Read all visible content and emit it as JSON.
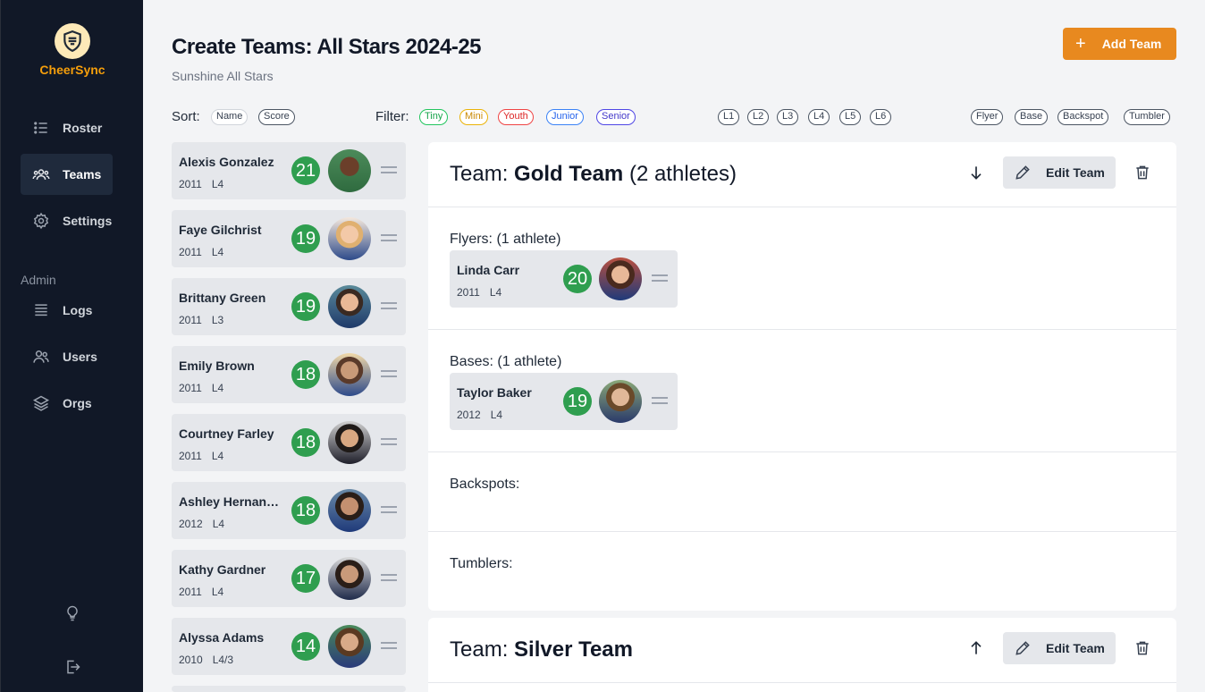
{
  "app": {
    "name": "CheerSync"
  },
  "nav": {
    "items": [
      {
        "label": "Roster",
        "icon": "list-icon"
      },
      {
        "label": "Teams",
        "icon": "people-icon",
        "active": true
      },
      {
        "label": "Settings",
        "icon": "gear-icon"
      }
    ],
    "admin_label": "Admin",
    "admin_items": [
      {
        "label": "Logs",
        "icon": "log-icon"
      },
      {
        "label": "Users",
        "icon": "users-icon"
      },
      {
        "label": "Orgs",
        "icon": "layers-icon"
      }
    ]
  },
  "header": {
    "title": "Create Teams: All Stars 2024-25",
    "subtitle": "Sunshine All Stars",
    "add_team_label": "Add Team"
  },
  "sort": {
    "label": "Sort:",
    "options": [
      "Name",
      "Score"
    ]
  },
  "filter": {
    "label": "Filter:",
    "divisions": [
      {
        "label": "Tiny",
        "color": "#22c55e"
      },
      {
        "label": "Mini",
        "color": "#eab308"
      },
      {
        "label": "Youth",
        "color": "#ef4444"
      },
      {
        "label": "Junior",
        "color": "#3b82f6"
      },
      {
        "label": "Senior",
        "color": "#4f46e5"
      }
    ],
    "levels": [
      "L1",
      "L2",
      "L3",
      "L4",
      "L5",
      "L6"
    ],
    "positions": [
      "Flyer",
      "Base",
      "Backspot",
      "Tumbler"
    ]
  },
  "roster": [
    {
      "name": "Alexis Gonzalez",
      "year": "2011",
      "level": "L4",
      "score": "21"
    },
    {
      "name": "Faye Gilchrist",
      "year": "2011",
      "level": "L4",
      "score": "19"
    },
    {
      "name": "Brittany Green",
      "year": "2011",
      "level": "L3",
      "score": "19"
    },
    {
      "name": "Emily Brown",
      "year": "2011",
      "level": "L4",
      "score": "18"
    },
    {
      "name": "Courtney Farley",
      "year": "2011",
      "level": "L4",
      "score": "18"
    },
    {
      "name": "Ashley Hernandez",
      "year": "2012",
      "level": "L4",
      "score": "18"
    },
    {
      "name": "Kathy Gardner",
      "year": "2011",
      "level": "L4",
      "score": "17"
    },
    {
      "name": "Alyssa Adams",
      "year": "2010",
      "level": "L4/3",
      "score": "14"
    }
  ],
  "teams": [
    {
      "prefix": "Team: ",
      "name": "Gold Team",
      "count": " (2 athletes)",
      "edit_label": "Edit Team",
      "sections": {
        "flyers": {
          "label": "Flyers: (1 athlete)",
          "athlete": {
            "name": "Linda Carr",
            "year": "2011",
            "level": "L4",
            "score": "20"
          }
        },
        "bases": {
          "label": "Bases: (1 athlete)",
          "athlete": {
            "name": "Taylor Baker",
            "year": "2012",
            "level": "L4",
            "score": "19"
          }
        },
        "backspots": {
          "label": "Backspots:"
        },
        "tumblers": {
          "label": "Tumblers:"
        }
      }
    },
    {
      "prefix": "Team: ",
      "name": "Silver Team",
      "edit_label": "Edit Team"
    }
  ],
  "colors": {
    "accent": "#e8891f",
    "score_green": "#2f9e4f",
    "sidebar": "#111827"
  }
}
